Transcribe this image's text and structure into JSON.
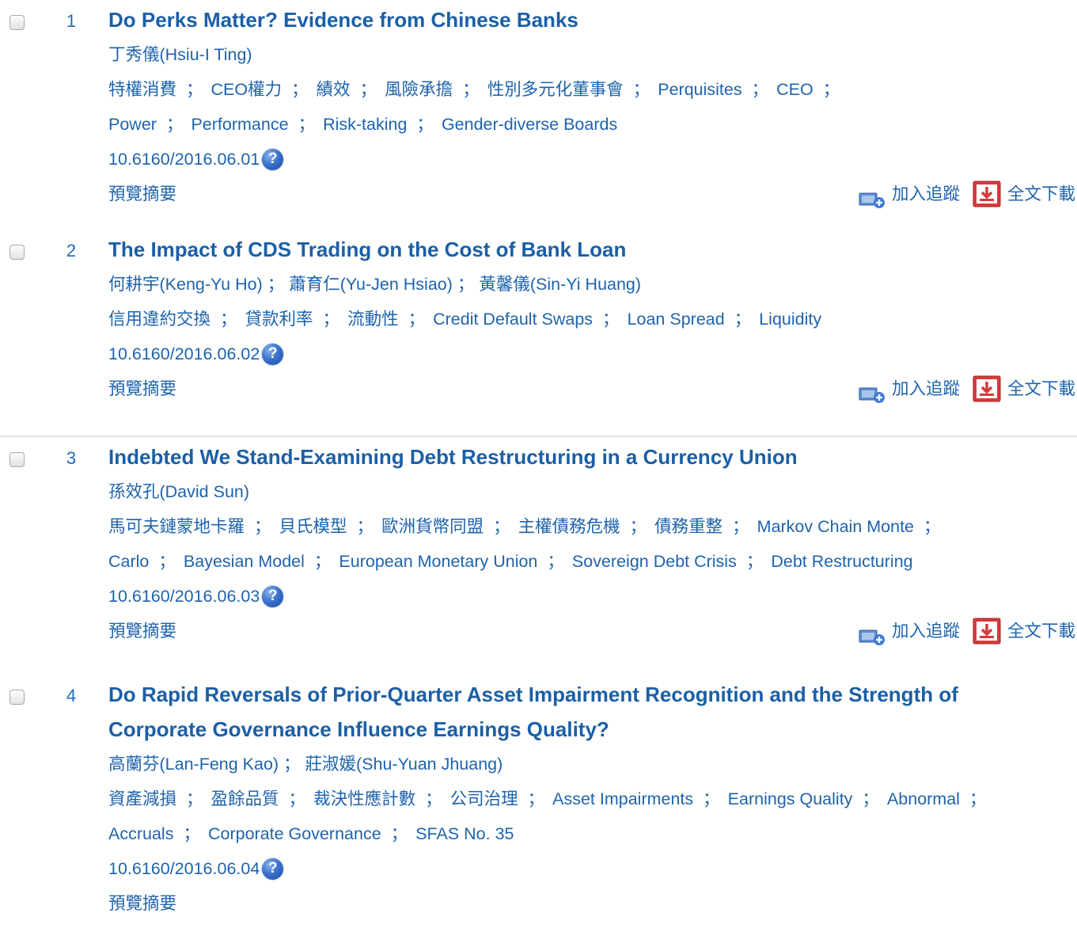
{
  "labels": {
    "abstract": "預覽摘要",
    "track": "加入追蹤",
    "download": "全文下載",
    "separator": "；",
    "help_mark": "?"
  },
  "articles": [
    {
      "number": "1",
      "title_lines": [
        "Do Perks Matter? Evidence from Chinese Banks"
      ],
      "authors": "丁秀儀(Hsiu-I Ting)",
      "keyword_lines": [
        [
          "特權消費",
          "CEO權力",
          "績效",
          "風險承擔",
          "性別多元化董事會",
          "Perquisites",
          "CEO"
        ],
        [
          "Power",
          "Performance",
          "Risk-taking",
          "Gender-diverse Boards"
        ]
      ],
      "doi": "10.6160/2016.06.01",
      "has_actions": true
    },
    {
      "number": "2",
      "title_lines": [
        "The Impact of CDS Trading on the Cost of Bank Loan"
      ],
      "authors": "何耕宇(Keng-Yu Ho) ； 蕭育仁(Yu-Jen Hsiao) ； 黃馨儀(Sin-Yi Huang)",
      "keyword_lines": [
        [
          "信用違約交換",
          "貸款利率",
          "流動性",
          "Credit Default Swaps",
          "Loan Spread",
          "Liquidity"
        ]
      ],
      "doi": "10.6160/2016.06.02",
      "has_actions": true
    },
    {
      "number": "3",
      "title_lines": [
        "Indebted We Stand-Examining Debt Restructuring in a Currency Union"
      ],
      "authors": "孫效孔(David Sun)",
      "keyword_lines": [
        [
          "馬可夫鏈蒙地卡羅",
          "貝氏模型",
          "歐洲貨幣同盟",
          "主權債務危機",
          "債務重整",
          "Markov Chain Monte"
        ],
        [
          "Carlo",
          "Bayesian Model",
          "European Monetary Union",
          "Sovereign Debt Crisis",
          "Debt Restructuring"
        ]
      ],
      "doi": "10.6160/2016.06.03",
      "has_actions": true
    },
    {
      "number": "4",
      "title_lines": [
        "Do Rapid Reversals of Prior-Quarter Asset Impairment Recognition and the Strength of",
        "Corporate Governance Influence Earnings Quality?"
      ],
      "authors": "高蘭芬(Lan-Feng Kao) ； 莊淑媛(Shu-Yuan Jhuang)",
      "keyword_lines": [
        [
          "資產減損",
          "盈餘品質",
          "裁決性應計數",
          "公司治理",
          "Asset Impairments",
          "Earnings Quality",
          "Abnormal"
        ],
        [
          "Accruals",
          "Corporate Governance",
          "SFAS No. 35"
        ]
      ],
      "doi": "10.6160/2016.06.04",
      "has_actions": false
    }
  ]
}
